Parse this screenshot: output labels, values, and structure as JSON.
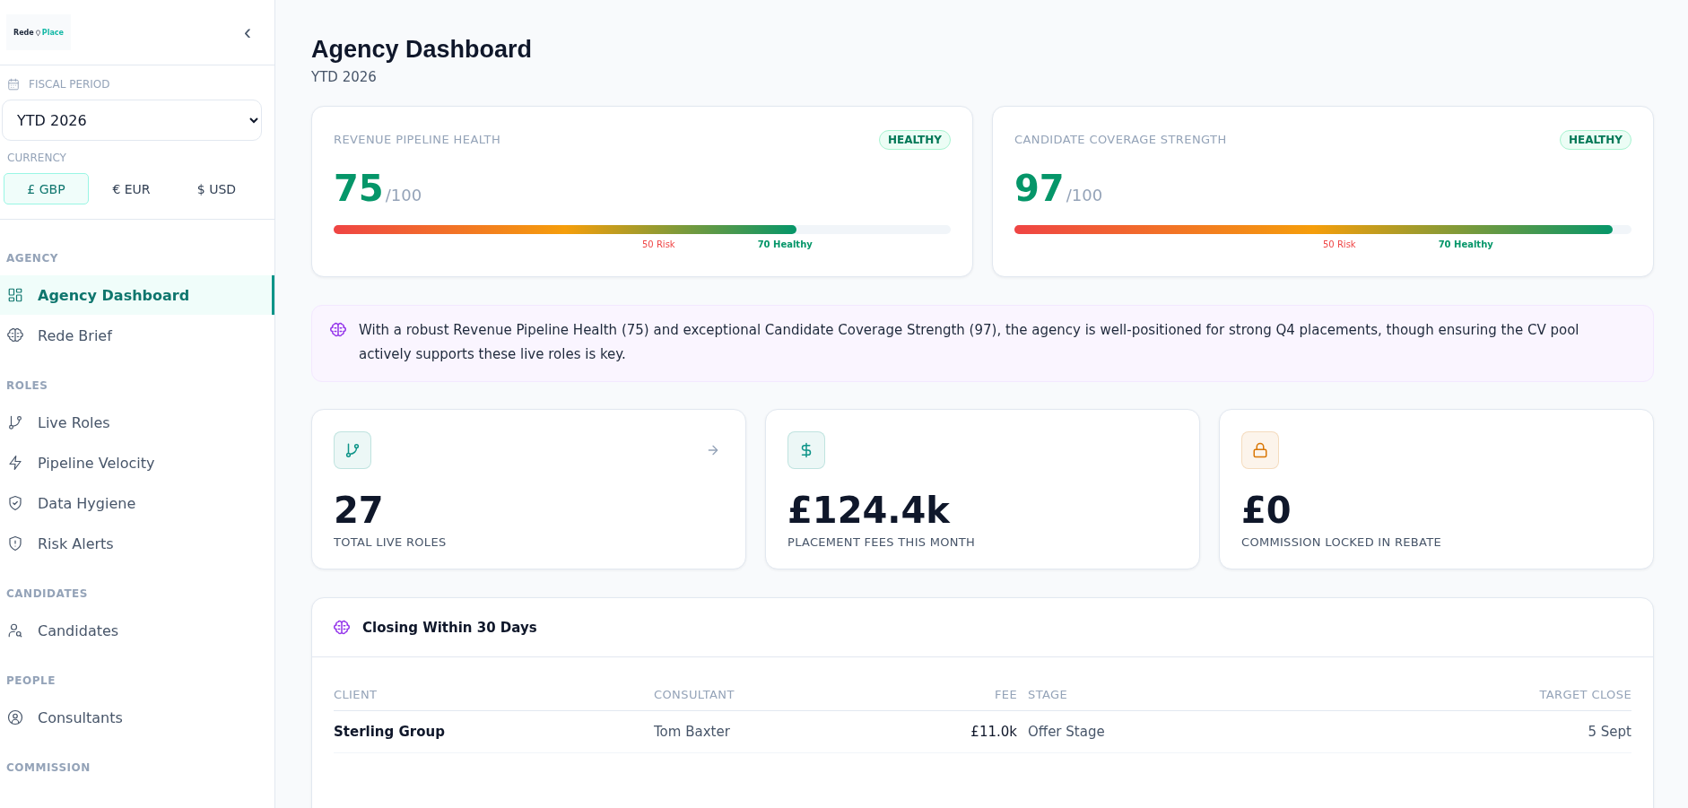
{
  "sidebar": {
    "logo": {
      "left": "Rede",
      "right": "Place"
    },
    "collapse_icon": "‹",
    "fiscal_period": {
      "label": "FISCAL PERIOD",
      "value": "YTD 2026"
    },
    "currency": {
      "label": "CURRENCY",
      "options": [
        {
          "label": "£ GBP",
          "selected": true
        },
        {
          "label": "€ EUR",
          "selected": false
        },
        {
          "label": "$ USD",
          "selected": false
        }
      ]
    },
    "sections": [
      {
        "title": "AGENCY",
        "items": [
          {
            "label": "Agency Dashboard",
            "selected": true
          },
          {
            "label": "Rede Brief",
            "selected": false
          }
        ]
      },
      {
        "title": "ROLES",
        "items": [
          {
            "label": "Live Roles",
            "selected": false
          },
          {
            "label": "Pipeline Velocity",
            "selected": false
          },
          {
            "label": "Data Hygiene",
            "selected": false
          },
          {
            "label": "Risk Alerts",
            "selected": false
          }
        ]
      },
      {
        "title": "CANDIDATES",
        "items": [
          {
            "label": "Candidates",
            "selected": false
          }
        ]
      },
      {
        "title": "PEOPLE",
        "items": [
          {
            "label": "Consultants",
            "selected": false
          }
        ]
      },
      {
        "title": "COMMISSION"
      }
    ]
  },
  "header": {
    "title": "Agency Dashboard",
    "subtitle": "YTD 2026"
  },
  "health_cards": [
    {
      "title": "REVENUE PIPELINE HEALTH",
      "badge": "HEALTHY",
      "score": "75",
      "max": "/100",
      "level": 0.75,
      "markers": [
        {
          "label": "50 Risk",
          "kind": "risk"
        },
        {
          "label": "70 Healthy",
          "kind": "healthy"
        }
      ]
    },
    {
      "title": "CANDIDATE COVERAGE STRENGTH",
      "badge": "HEALTHY",
      "score": "97",
      "max": "/100",
      "level": 0.97,
      "markers": [
        {
          "label": "50 Risk",
          "kind": "risk"
        },
        {
          "label": "70 Healthy",
          "kind": "healthy"
        }
      ]
    }
  ],
  "insight": {
    "text": "With a robust Revenue Pipeline Health (75) and exceptional Candidate Coverage Strength (97), the agency is well-positioned for strong Q4 placements, though ensuring the CV pool actively supports these live roles is key."
  },
  "stats": [
    {
      "color": "#0d9488",
      "value": "27",
      "label": "TOTAL LIVE ROLES",
      "link": true
    },
    {
      "color": "#0d9488",
      "value": "£124.4k",
      "label": "PLACEMENT FEES THIS MONTH",
      "link": false
    },
    {
      "color": "#d97706",
      "value": "£0",
      "label": "COMMISSION LOCKED IN REBATE",
      "link": false
    }
  ],
  "closing_table": {
    "title": "Closing Within 30 Days",
    "columns": [
      "CLIENT",
      "CONSULTANT",
      "FEE",
      "STAGE",
      "TARGET CLOSE"
    ],
    "rows": [
      [
        "Sterling Group",
        "Tom Baxter",
        "£11.0k",
        "Offer Stage",
        "5 Sept"
      ]
    ]
  }
}
